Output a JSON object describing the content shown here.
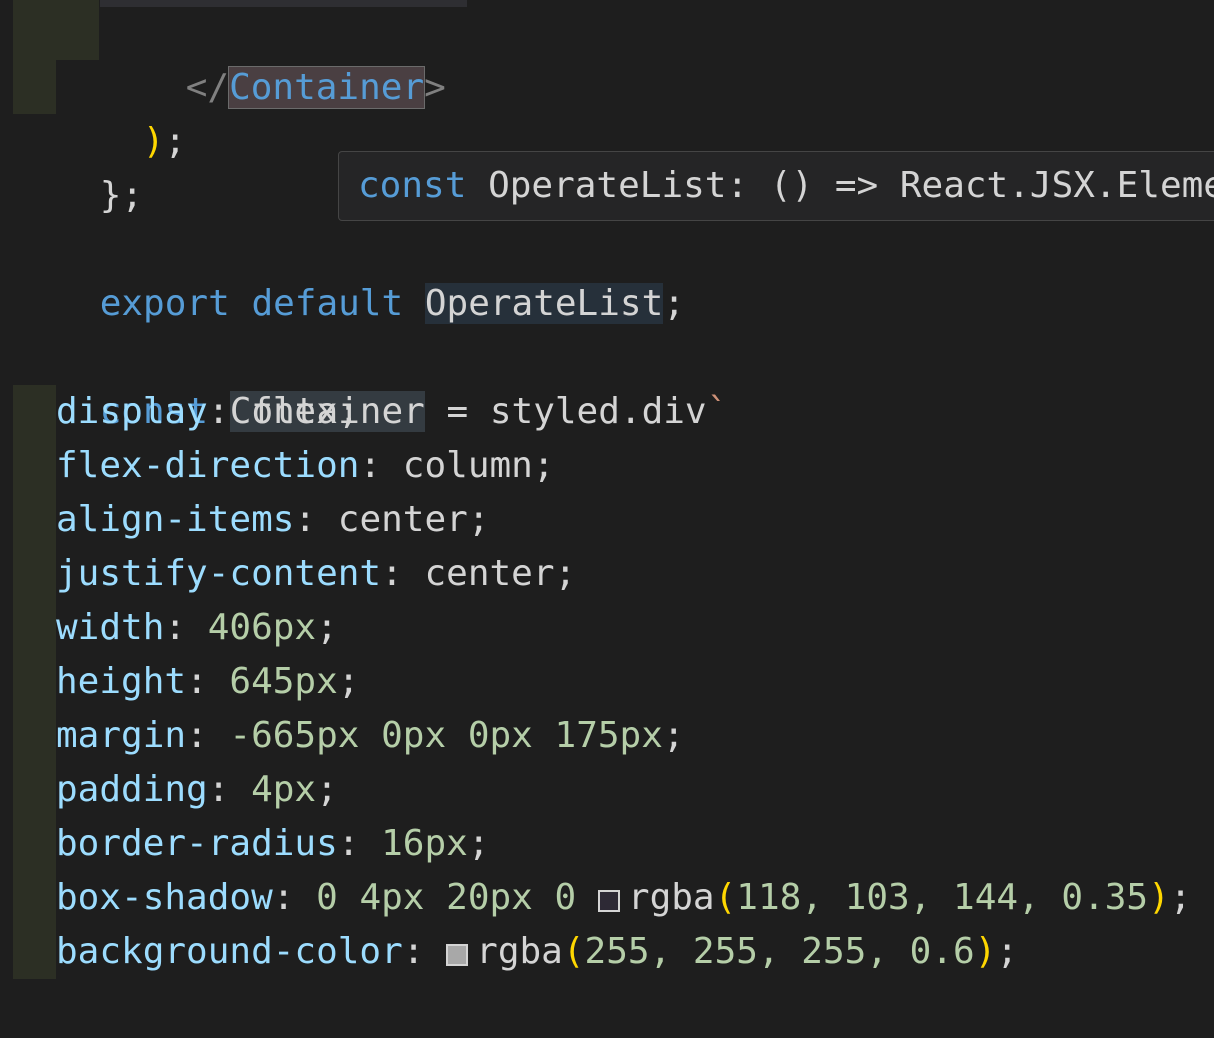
{
  "editor": {
    "colors": {
      "background": "#1e1e1e",
      "keyword": "#569cd6",
      "property": "#9cdcfe",
      "number": "#b5cea8",
      "bracket": "#ffd700"
    },
    "lines": {
      "close_tag_open": "</",
      "close_tag_name": "Container",
      "close_tag_end": ">",
      "return_close_paren": ")",
      "return_close_semi": ";",
      "fn_close": "};",
      "export_kw": "export",
      "default_kw": "default",
      "export_name": "OperateList",
      "export_semi": ";",
      "const_kw": "const",
      "const_name": "Container",
      "const_rest": " = styled.div",
      "const_tick": "`",
      "css": [
        {
          "prop": "display",
          "value": "flex"
        },
        {
          "prop": "flex-direction",
          "value": "column"
        },
        {
          "prop": "align-items",
          "value": "center"
        },
        {
          "prop": "justify-content",
          "value": "center"
        },
        {
          "prop": "width",
          "value": "406px"
        },
        {
          "prop": "height",
          "value": "645px"
        },
        {
          "prop": "margin",
          "value": "-665px 0px 0px 175px"
        },
        {
          "prop": "padding",
          "value": "4px"
        },
        {
          "prop": "border-radius",
          "value": "16px"
        }
      ],
      "box_shadow": {
        "prop": "box-shadow",
        "prefix": "0 4px 20px 0",
        "fn": "rgba",
        "args": "118, 103, 144, 0.35",
        "swatch_color": "#2d2935"
      },
      "background_color": {
        "prop": "background-color",
        "fn": "rgba",
        "args": "255, 255, 255, 0.6",
        "swatch_color": "#a8a8a8"
      },
      "closing_tick": "`",
      "closing_semi": ";"
    }
  },
  "hover": {
    "keyword": "const",
    "signature": "OperateList: () => React.JSX.Element"
  }
}
